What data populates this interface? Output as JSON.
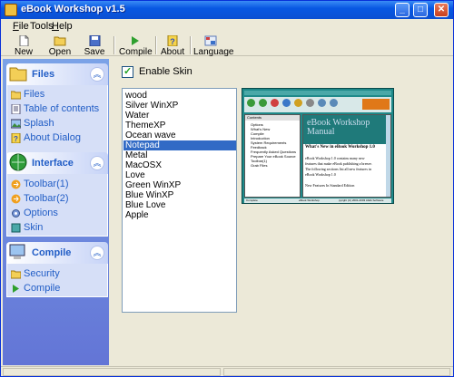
{
  "window": {
    "title": "eBook Workshop v1.5"
  },
  "menu": [
    {
      "label": "File",
      "key": "F",
      "rest": "ile"
    },
    {
      "label": "Tools",
      "key": "",
      "rest": "Tools"
    },
    {
      "label": "Help",
      "key": "H",
      "rest": "elp"
    }
  ],
  "toolbar": {
    "new": "New",
    "open": "Open",
    "save": "Save",
    "compile": "Compile",
    "about": "About",
    "language": "Language"
  },
  "sidebar": {
    "files": {
      "title": "Files",
      "items": [
        "Files",
        "Table of contents",
        "Splash",
        "About Dialog"
      ]
    },
    "interface": {
      "title": "Interface",
      "items": [
        "Toolbar(1)",
        "Toolbar(2)",
        "Options",
        "Skin"
      ]
    },
    "compile": {
      "title": "Compile",
      "items": [
        "Security",
        "Compile"
      ]
    }
  },
  "skin": {
    "enable_label": "Enable Skin",
    "enabled": true,
    "selected": "Notepad",
    "items": [
      "wood",
      "Silver WinXP",
      "Water",
      "ThemeXP",
      "Ocean wave",
      "Notepad",
      "Metal",
      "MacOSX",
      "Love",
      "Green WinXP",
      "Blue WinXP",
      "Blue Love",
      "Apple"
    ]
  },
  "preview": {
    "toc_header": "Contents",
    "toc": [
      "Options",
      "What's New",
      "Compile",
      "Introduction",
      "System Requirements",
      "Feedback",
      "Frequently Asked Questions",
      "Prepare Your eBook Source",
      "Toolbar(1)",
      "Grab Files"
    ],
    "banner": "eBook Workshop Manual",
    "heading": "What's New in eBook Workshop 1.0",
    "body": [
      "eBook Workshop 1.0 contains many new",
      "features that make eBook publishing a breeze.",
      "The following sections list all new features in",
      "eBook Workshop 1.0",
      "",
      "New Features In Standard Edition"
    ],
    "status_left": "Complete",
    "status_mid": "eBook Workshop",
    "status_right": "pyright (C) 2001-2003 Abdk Software"
  },
  "colors": {
    "titlebar": "#0858e3",
    "sidebar": "#6f8ddf",
    "selection": "#316ac5",
    "link": "#215dc6"
  }
}
